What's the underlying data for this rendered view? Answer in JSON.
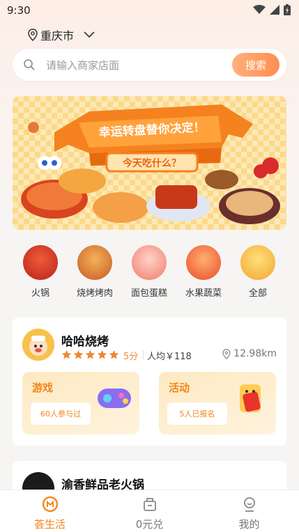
{
  "status_bar": {
    "time": "9:30"
  },
  "location": {
    "city": "重庆市"
  },
  "search": {
    "placeholder": "请输入商家店面",
    "button_label": "搜索"
  },
  "banner": {
    "headline": "幸运转盘替你决定！",
    "subline": "今天吃什么？"
  },
  "categories": [
    {
      "label": "火锅",
      "icon": "hotpot-icon"
    },
    {
      "label": "烧烤烤肉",
      "icon": "bbq-skewer-icon"
    },
    {
      "label": "面包蛋糕",
      "icon": "cake-icon"
    },
    {
      "label": "水果蔬菜",
      "icon": "fruit-icon"
    },
    {
      "label": "全部",
      "icon": "all-icon"
    }
  ],
  "shops": [
    {
      "name": "哈哈烧烤",
      "rating_stars": 5,
      "score": "5分",
      "avg_price": "人均￥118",
      "distance": "12.98km",
      "promos": [
        {
          "title": "游戏",
          "pill": "60人参与过"
        },
        {
          "title": "活动",
          "pill": "5人已报名"
        }
      ]
    },
    {
      "name": "渝香鲜品老火锅"
    }
  ],
  "tab_bar": {
    "items": [
      {
        "label": "荟生活",
        "active": true
      },
      {
        "label": "0元兑",
        "active": false
      },
      {
        "label": "我的",
        "active": false
      }
    ]
  },
  "colors": {
    "accent": "#f4861f",
    "search_btn": "#ff9a5e",
    "star": "#f5a623"
  }
}
